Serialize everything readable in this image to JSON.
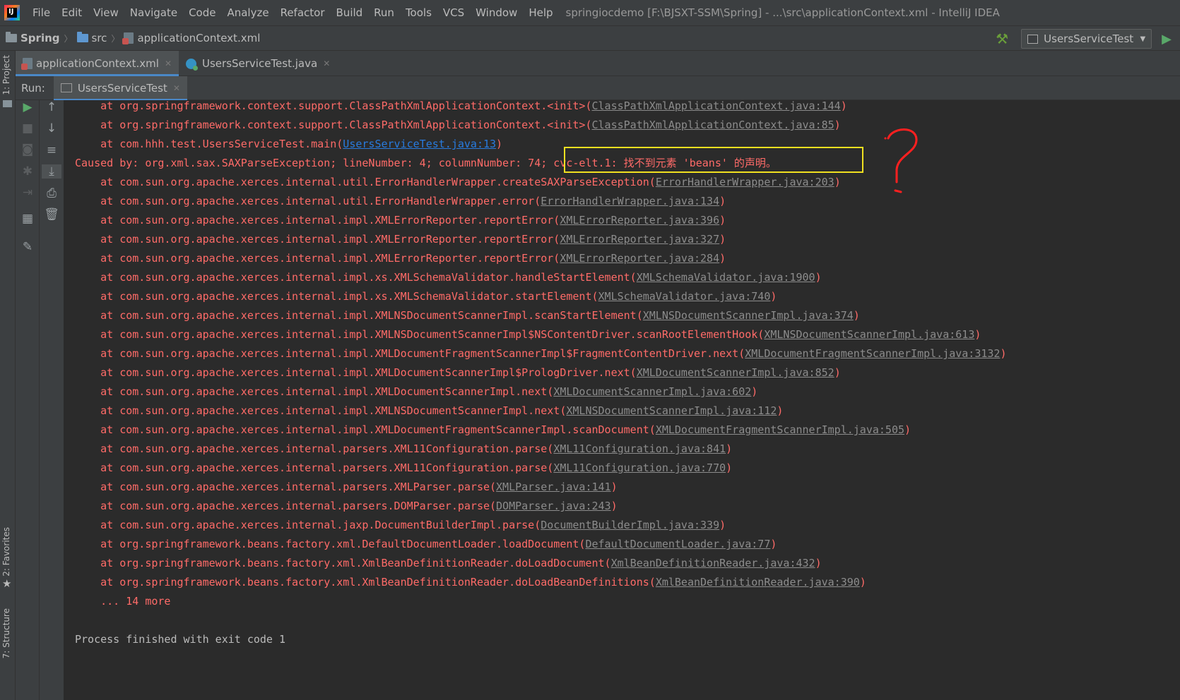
{
  "menubar": {
    "logo_text": "IJ",
    "items": [
      "File",
      "Edit",
      "View",
      "Navigate",
      "Code",
      "Analyze",
      "Refactor",
      "Build",
      "Run",
      "Tools",
      "VCS",
      "Window",
      "Help"
    ],
    "window_title": "springiocdemo [F:\\BJSXT-SSM\\Spring] - ...\\src\\applicationContext.xml - IntelliJ IDEA"
  },
  "navbar": {
    "breadcrumbs": [
      "Spring",
      "src",
      "applicationContext.xml"
    ],
    "run_config": "UsersServiceTest"
  },
  "left_strip": {
    "project": "1: Project",
    "favorites": "2: Favorites",
    "structure": "7: Structure"
  },
  "editor_tabs": [
    {
      "label": "applicationContext.xml",
      "active": true
    },
    {
      "label": "UsersServiceTest.java",
      "active": false
    }
  ],
  "run_panel": {
    "label": "Run:",
    "tab": "UsersServiceTest"
  },
  "console": {
    "lines": [
      {
        "pre": "    at org.springframework.context.support.ClassPathXmlApplicationContext.<init>(",
        "link": "ClassPathXmlApplicationContext.java:144",
        "post": ")"
      },
      {
        "pre": "    at org.springframework.context.support.ClassPathXmlApplicationContext.<init>(",
        "link": "ClassPathXmlApplicationContext.java:85",
        "post": ")"
      },
      {
        "pre": "    at com.hhh.test.UsersServiceTest.main(",
        "link": "UsersServiceTest.java:13",
        "post": ")",
        "blue": true
      },
      {
        "pre": "Caused by: org.xml.sax.SAXParseException; lineNumber: 4; columnNumber: 74; cvc-elt.1: 找不到元素 'beans' 的声明。",
        "link": "",
        "post": ""
      },
      {
        "pre": "    at com.sun.org.apache.xerces.internal.util.ErrorHandlerWrapper.createSAXParseException(",
        "link": "ErrorHandlerWrapper.java:203",
        "post": ")"
      },
      {
        "pre": "    at com.sun.org.apache.xerces.internal.util.ErrorHandlerWrapper.error(",
        "link": "ErrorHandlerWrapper.java:134",
        "post": ")"
      },
      {
        "pre": "    at com.sun.org.apache.xerces.internal.impl.XMLErrorReporter.reportError(",
        "link": "XMLErrorReporter.java:396",
        "post": ")"
      },
      {
        "pre": "    at com.sun.org.apache.xerces.internal.impl.XMLErrorReporter.reportError(",
        "link": "XMLErrorReporter.java:327",
        "post": ")"
      },
      {
        "pre": "    at com.sun.org.apache.xerces.internal.impl.XMLErrorReporter.reportError(",
        "link": "XMLErrorReporter.java:284",
        "post": ")"
      },
      {
        "pre": "    at com.sun.org.apache.xerces.internal.impl.xs.XMLSchemaValidator.handleStartElement(",
        "link": "XMLSchemaValidator.java:1900",
        "post": ")"
      },
      {
        "pre": "    at com.sun.org.apache.xerces.internal.impl.xs.XMLSchemaValidator.startElement(",
        "link": "XMLSchemaValidator.java:740",
        "post": ")"
      },
      {
        "pre": "    at com.sun.org.apache.xerces.internal.impl.XMLNSDocumentScannerImpl.scanStartElement(",
        "link": "XMLNSDocumentScannerImpl.java:374",
        "post": ")"
      },
      {
        "pre": "    at com.sun.org.apache.xerces.internal.impl.XMLNSDocumentScannerImpl$NSContentDriver.scanRootElementHook(",
        "link": "XMLNSDocumentScannerImpl.java:613",
        "post": ")"
      },
      {
        "pre": "    at com.sun.org.apache.xerces.internal.impl.XMLDocumentFragmentScannerImpl$FragmentContentDriver.next(",
        "link": "XMLDocumentFragmentScannerImpl.java:3132",
        "post": ")"
      },
      {
        "pre": "    at com.sun.org.apache.xerces.internal.impl.XMLDocumentScannerImpl$PrologDriver.next(",
        "link": "XMLDocumentScannerImpl.java:852",
        "post": ")"
      },
      {
        "pre": "    at com.sun.org.apache.xerces.internal.impl.XMLDocumentScannerImpl.next(",
        "link": "XMLDocumentScannerImpl.java:602",
        "post": ")"
      },
      {
        "pre": "    at com.sun.org.apache.xerces.internal.impl.XMLNSDocumentScannerImpl.next(",
        "link": "XMLNSDocumentScannerImpl.java:112",
        "post": ")"
      },
      {
        "pre": "    at com.sun.org.apache.xerces.internal.impl.XMLDocumentFragmentScannerImpl.scanDocument(",
        "link": "XMLDocumentFragmentScannerImpl.java:505",
        "post": ")"
      },
      {
        "pre": "    at com.sun.org.apache.xerces.internal.parsers.XML11Configuration.parse(",
        "link": "XML11Configuration.java:841",
        "post": ")"
      },
      {
        "pre": "    at com.sun.org.apache.xerces.internal.parsers.XML11Configuration.parse(",
        "link": "XML11Configuration.java:770",
        "post": ")"
      },
      {
        "pre": "    at com.sun.org.apache.xerces.internal.parsers.XMLParser.parse(",
        "link": "XMLParser.java:141",
        "post": ")"
      },
      {
        "pre": "    at com.sun.org.apache.xerces.internal.parsers.DOMParser.parse(",
        "link": "DOMParser.java:243",
        "post": ")"
      },
      {
        "pre": "    at com.sun.org.apache.xerces.internal.jaxp.DocumentBuilderImpl.parse(",
        "link": "DocumentBuilderImpl.java:339",
        "post": ")"
      },
      {
        "pre": "    at org.springframework.beans.factory.xml.DefaultDocumentLoader.loadDocument(",
        "link": "DefaultDocumentLoader.java:77",
        "post": ")"
      },
      {
        "pre": "    at org.springframework.beans.factory.xml.XmlBeanDefinitionReader.doLoadDocument(",
        "link": "XmlBeanDefinitionReader.java:432",
        "post": ")"
      },
      {
        "pre": "    at org.springframework.beans.factory.xml.XmlBeanDefinitionReader.doLoadBeanDefinitions(",
        "link": "XmlBeanDefinitionReader.java:390",
        "post": ")"
      },
      {
        "pre": "    ... 14 more",
        "link": "",
        "post": ""
      }
    ],
    "finished": "Process finished with exit code 1"
  },
  "colors": {
    "error_text": "#ff6b68",
    "link_gray": "#8c8c8c",
    "link_blue": "#287bde",
    "highlight_box": "#f0e020",
    "annotation": "#ff2020"
  }
}
